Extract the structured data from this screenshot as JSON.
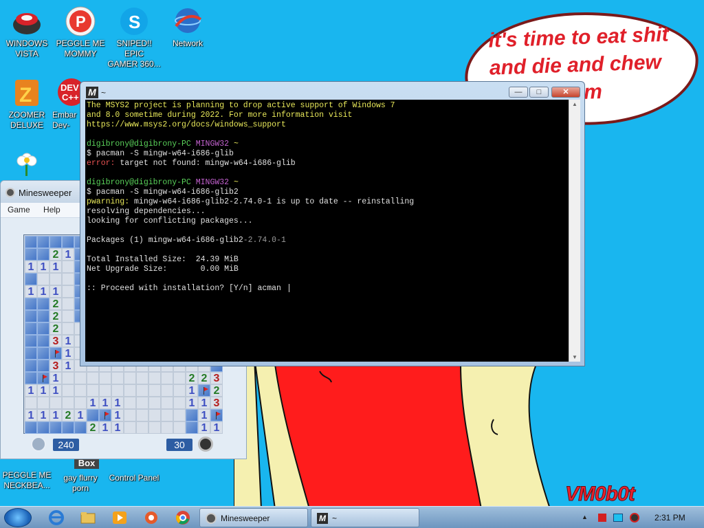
{
  "desktop": {
    "icons": [
      {
        "label": "WINDOWS\nVISTA",
        "icon": "cherry-pot-icon"
      },
      {
        "label": "PEGGLE ME\nMOMMY",
        "icon": "peggle-icon"
      },
      {
        "label": "SNIPED!! EPIC\nGAMER 360...",
        "icon": "skype-icon"
      },
      {
        "label": "Network",
        "icon": "network-globe-icon"
      },
      {
        "label": "ZOOMER\nDELUXE",
        "icon": "zoomer-icon"
      },
      {
        "label": "Embar\nDev-",
        "icon": "dev-cpp-icon"
      },
      {
        "label": "",
        "icon": "flower-icon"
      },
      {
        "label": "PEGGLE ME\nNECKBEA...",
        "icon": "peggle-icon"
      },
      {
        "label": "gay flurry\nporn",
        "icon": "box-icon"
      },
      {
        "label": "Control Panel",
        "icon": "control-panel-icon"
      }
    ],
    "box_text": "Box",
    "bubble": {
      "line1": "it's time to eat shit",
      "line2": "and die and chew",
      "line3": "m"
    },
    "watermark": "VM0b0t"
  },
  "minesweeper": {
    "title": "Minesweeper",
    "menu": [
      "Game",
      "Help"
    ],
    "timer": "240",
    "mines": "30",
    "rows": [
      "HHHHHH..........",
      "HH21H...........",
      "111.H...........",
      "H...H...........",
      "111.H...........",
      "HH2.H...........",
      "HH2.H...........",
      "HH2.............",
      "HH31............",
      "HHF1............",
      "HH31...........H",
      "HF1..........2231",
      "111..........1F2F",
      ".....111.....1132",
      "11121HF1.....H1F",
      "HHHHH211.....H11"
    ]
  },
  "terminal": {
    "title": "~",
    "lines": [
      [
        {
          "t": "The MSYS2 project is planning to drop active support of Windows 7",
          "c": "yl"
        }
      ],
      [
        {
          "t": "and 8.0 sometime during 2022. For more information visit",
          "c": "yl"
        }
      ],
      [
        {
          "t": "https://www.msys2.org/docs/windows_support",
          "c": "yl"
        }
      ],
      [
        {
          "t": "",
          "c": ""
        }
      ],
      [
        {
          "t": "digibrony@digibrony-PC ",
          "c": "gr"
        },
        {
          "t": "MINGW32 ",
          "c": "mg"
        },
        {
          "t": "~",
          "c": "yl"
        }
      ],
      [
        {
          "t": "$ pacman -S mingw-w64-i686-glib",
          "c": ""
        }
      ],
      [
        {
          "t": "error: ",
          "c": "rd"
        },
        {
          "t": "target not found: mingw-w64-i686-glib",
          "c": ""
        }
      ],
      [
        {
          "t": "",
          "c": ""
        }
      ],
      [
        {
          "t": "digibrony@digibrony-PC ",
          "c": "gr"
        },
        {
          "t": "MINGW32 ",
          "c": "mg"
        },
        {
          "t": "~",
          "c": "yl"
        }
      ],
      [
        {
          "t": "$ pacman -S mingw-w64-i686-glib2",
          "c": ""
        }
      ],
      [
        {
          "t": "pwarning: ",
          "c": "yl"
        },
        {
          "t": "mingw-w64-i686-glib2-2.74.0-1 is up to date -- reinstalling",
          "c": ""
        }
      ],
      [
        {
          "t": "resolving dependencies...",
          "c": ""
        }
      ],
      [
        {
          "t": "looking for conflicting packages...",
          "c": ""
        }
      ],
      [
        {
          "t": "",
          "c": ""
        }
      ],
      [
        {
          "t": "Packages (1) ",
          "c": ""
        },
        {
          "t": "mingw-w64-i686-glib2",
          "c": ""
        },
        {
          "t": "-2.74.0-1",
          "c": "dim"
        }
      ],
      [
        {
          "t": "",
          "c": ""
        }
      ],
      [
        {
          "t": "Total Installed Size:  24.39 MiB",
          "c": ""
        }
      ],
      [
        {
          "t": "Net Upgrade Size:       0.00 MiB",
          "c": ""
        }
      ],
      [
        {
          "t": "",
          "c": ""
        }
      ],
      [
        {
          "t": ":: Proceed with installation? [Y/n] acman ",
          "c": ""
        }
      ]
    ]
  },
  "taskbar": {
    "buttons": [
      {
        "label": "Minesweeper",
        "icon": "minesweeper-icon"
      },
      {
        "label": "~",
        "icon": "msys2-icon"
      }
    ],
    "clock": "2:31 PM"
  }
}
